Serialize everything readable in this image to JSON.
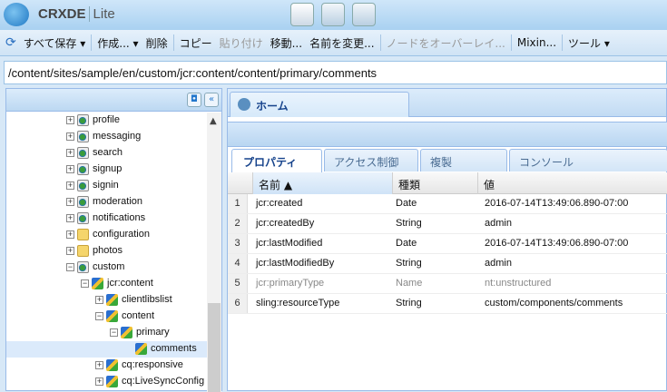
{
  "app": {
    "name": "CRXDE",
    "sub": "Lite",
    "accent": "#99bbe8"
  },
  "header_buttons": [
    {
      "icon": "tools-icon"
    },
    {
      "icon": "package-icon"
    },
    {
      "icon": "console-icon"
    }
  ],
  "toolbar": {
    "items": [
      {
        "label": "すべて保存 ▾",
        "disabled": false
      },
      {
        "sep": true
      },
      {
        "label": "作成... ▾",
        "disabled": false
      },
      {
        "label": "削除",
        "disabled": false
      },
      {
        "sep": true
      },
      {
        "label": "コピー",
        "disabled": false
      },
      {
        "label": "貼り付け",
        "disabled": true
      },
      {
        "label": "移動...",
        "disabled": false
      },
      {
        "label": "名前を変更...",
        "disabled": false
      },
      {
        "sep": true
      },
      {
        "label": "ノードをオーバーレイ...",
        "disabled": true
      },
      {
        "sep": true
      },
      {
        "label": "Mixin...",
        "disabled": false
      },
      {
        "sep": true
      },
      {
        "label": "ツール ▾",
        "disabled": false
      }
    ]
  },
  "path": "/content/sites/sample/en/custom/jcr:content/content/primary/comments",
  "tree": [
    {
      "label": "profile",
      "level": 0,
      "icon": "page",
      "toggle": "+"
    },
    {
      "label": "messaging",
      "level": 0,
      "icon": "page",
      "toggle": "+"
    },
    {
      "label": "search",
      "level": 0,
      "icon": "page",
      "toggle": "+"
    },
    {
      "label": "signup",
      "level": 0,
      "icon": "page",
      "toggle": "+"
    },
    {
      "label": "signin",
      "level": 0,
      "icon": "page",
      "toggle": "+"
    },
    {
      "label": "moderation",
      "level": 0,
      "icon": "page",
      "toggle": "+"
    },
    {
      "label": "notifications",
      "level": 0,
      "icon": "page",
      "toggle": "+"
    },
    {
      "label": "configuration",
      "level": 0,
      "icon": "folder",
      "toggle": "+"
    },
    {
      "label": "photos",
      "level": 0,
      "icon": "folder",
      "toggle": "+"
    },
    {
      "label": "custom",
      "level": 0,
      "icon": "page",
      "toggle": "-"
    },
    {
      "label": "jcr:content",
      "level": 1,
      "icon": "node",
      "toggle": "-"
    },
    {
      "label": "clientlibslist",
      "level": 2,
      "icon": "node",
      "toggle": "+"
    },
    {
      "label": "content",
      "level": 2,
      "icon": "node",
      "toggle": "-"
    },
    {
      "label": "primary",
      "level": 3,
      "icon": "node",
      "toggle": "-"
    },
    {
      "label": "comments",
      "level": 4,
      "icon": "node",
      "toggle": "",
      "selected": true
    },
    {
      "label": "cq:responsive",
      "level": 2,
      "icon": "node",
      "toggle": "+"
    },
    {
      "label": "cq:LiveSyncConfig",
      "level": 2,
      "icon": "node",
      "toggle": "+"
    }
  ],
  "main_tab": "ホーム",
  "sub_tabs": [
    "プロパティ",
    "アクセス制御",
    "複製",
    "コンソール"
  ],
  "columns": [
    "名前 ▲",
    "種類",
    "値"
  ],
  "rows": [
    {
      "n": "1",
      "name": "jcr:created",
      "type": "Date",
      "value": "2016-07-14T13:49:06.890-07:00"
    },
    {
      "n": "2",
      "name": "jcr:createdBy",
      "type": "String",
      "value": "admin"
    },
    {
      "n": "3",
      "name": "jcr:lastModified",
      "type": "Date",
      "value": "2016-07-14T13:49:06.890-07:00"
    },
    {
      "n": "4",
      "name": "jcr:lastModifiedBy",
      "type": "String",
      "value": "admin"
    },
    {
      "n": "5",
      "name": "jcr:primaryType",
      "type": "Name",
      "value": "nt:unstructured",
      "protected": true
    },
    {
      "n": "6",
      "name": "sling:resourceType",
      "type": "String",
      "value": "custom/components/comments"
    }
  ]
}
